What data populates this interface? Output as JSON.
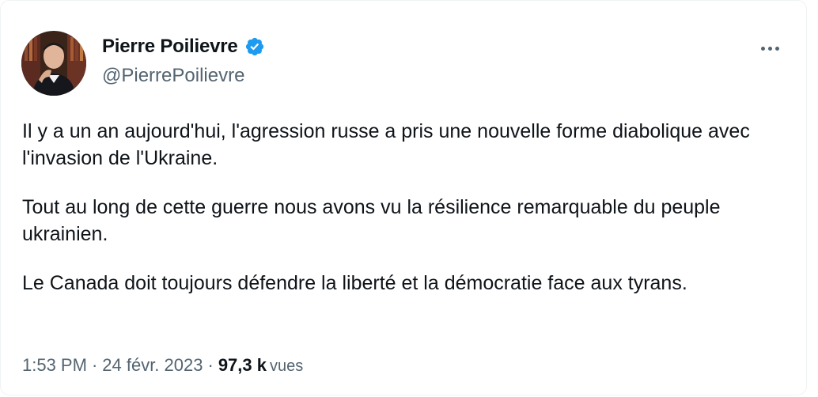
{
  "author": {
    "name": "Pierre Poilievre",
    "handle": "@PierrePoilievre",
    "verified_icon": "verified-badge-icon",
    "verified_color": "#1d9bf0"
  },
  "menu": {
    "icon": "more-options-icon"
  },
  "tweet": {
    "paragraphs": [
      "Il y a un an aujourd'hui, l'agression russe a pris une nouvelle forme diabolique avec l'invasion de l'Ukraine.",
      "Tout au long de cette guerre nous avons vu la résilience remarquable du peuple ukrainien.",
      "Le Canada doit toujours défendre la liberté et la démocratie face aux tyrans."
    ]
  },
  "meta": {
    "time": "1:53 PM",
    "separator": "·",
    "date": "24 févr. 2023",
    "views_count": "97,3 k",
    "views_label": "vues"
  },
  "colors": {
    "text_primary": "#0f1419",
    "text_secondary": "#536471",
    "border": "#eff3f4"
  }
}
